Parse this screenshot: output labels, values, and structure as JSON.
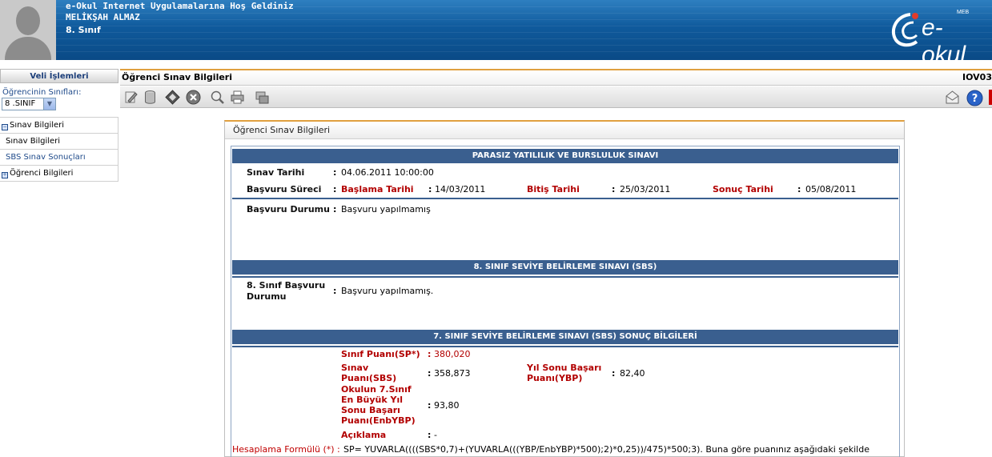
{
  "header": {
    "welcome": "e-Okul Internet Uygulamalarına Hoş Geldiniz",
    "user_name": "MELİKŞAH ALMAZ",
    "class_name": "8. Sınıf",
    "logo_text": "e-okul",
    "logo_small": "MEB"
  },
  "sidebar": {
    "title": "Veli İşlemleri",
    "class_label": "Öğrencinin Sınıfları:",
    "class_selected": "8 .SINIF",
    "menu": [
      {
        "label": "Sınav Bilgileri",
        "icon": "minus-box-icon"
      },
      {
        "label": "Sınav Bilgileri"
      },
      {
        "label": "SBS Sınav Sonuçları"
      },
      {
        "label": "Öğrenci Bilgileri",
        "icon": "plus-box-icon"
      }
    ]
  },
  "main": {
    "title": "Öğrenci Sınav Bilgileri",
    "code": "IOV03"
  },
  "panel": {
    "title": "Öğrenci Sınav Bilgileri",
    "sections": {
      "pybs": {
        "heading": "PARASIZ YATILILIK VE BURSLULUK SINAVI",
        "exam_date_label": "Sınav Tarihi",
        "exam_date_value": "04.06.2011 10:00:00",
        "application_period_label": "Başvuru Süreci",
        "start_label": "Başlama Tarihi",
        "start_value": "14/03/2011",
        "end_label": "Bitiş Tarihi",
        "end_value": "25/03/2011",
        "result_label": "Sonuç Tarihi",
        "result_value": "05/08/2011",
        "status_label": "Başvuru Durumu",
        "status_value": "Başvuru yapılmamış"
      },
      "sbs8": {
        "heading": "8. SINIF SEVİYE BELİRLEME SINAVI (SBS)",
        "status_label_1": "8. Sınıf Başvuru",
        "status_label_2": "Durumu",
        "status_value": "Başvuru yapılmamış."
      },
      "sbs7": {
        "heading": "7. SINIF SEVİYE BELİRLEME SINAVI (SBS) SONUÇ BİLGİLERİ",
        "class_score_label": "Sınıf Puanı(SP*)",
        "class_score_value": "380,020",
        "exam_score_label_1": "Sınav",
        "exam_score_label_2": "Puanı(SBS)",
        "exam_score_value": "358,873",
        "ybp_label_1": "Yıl Sonu Başarı",
        "ybp_label_2": "Puanı(YBP)",
        "ybp_value": "82,40",
        "enbybp_label_1": "Okulun 7.Sınıf",
        "enbybp_label_2": "En Büyük Yıl",
        "enbybp_label_3": "Sonu Başarı",
        "enbybp_label_4": "Puanı(EnbYBP)",
        "enbybp_value": "93,80",
        "note_label": "Açıklama",
        "note_value": "-",
        "formula_label": "Hesaplama Formülü (*) :",
        "formula_value": "SP= YUVARLA((((SBS*0,7)+(YUVARLA(((YBP/EnbYBP)*500);2)*0,25))/475)*500;3). Buna göre puanınız aşağıdaki şekilde"
      }
    }
  },
  "colors": {
    "header_blue": "#0f5a9c",
    "section_blue": "#3a5f8f",
    "accent_orange": "#e0a040",
    "label_red": "#b20000"
  }
}
